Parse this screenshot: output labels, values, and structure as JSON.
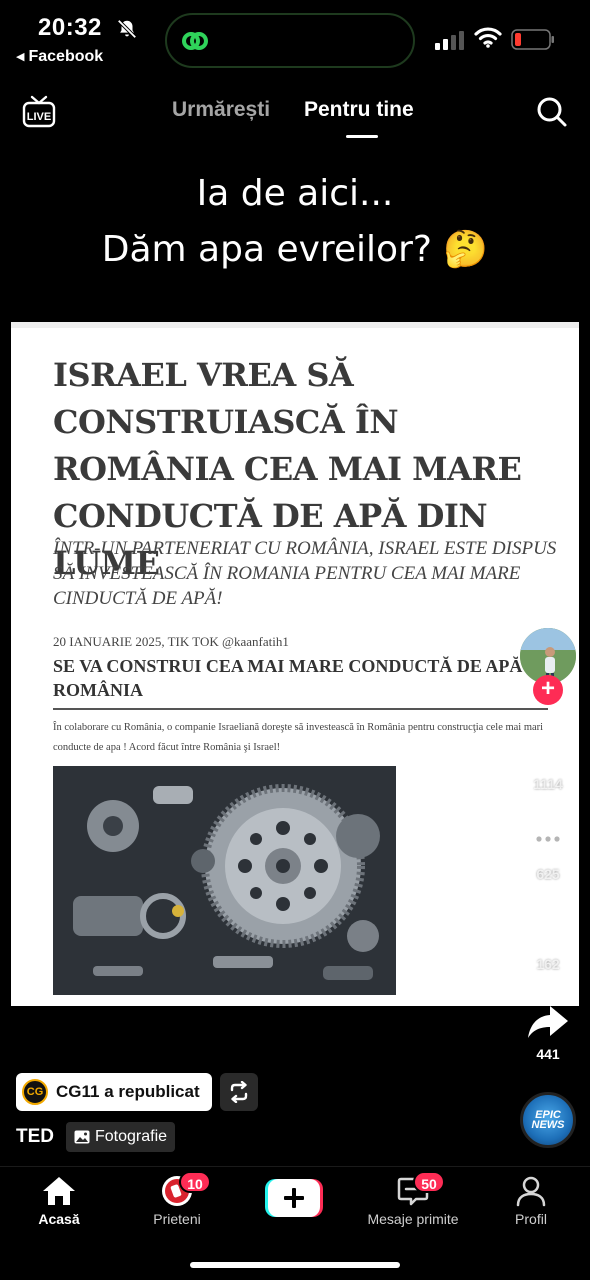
{
  "status_bar": {
    "time": "20:32",
    "back_app": "Facebook",
    "battery_level": 0.15
  },
  "top_nav": {
    "tab_following": "Urmărești",
    "tab_for_you": "Pentru tine",
    "active_tab": "Pentru tine"
  },
  "caption": {
    "line1": "Ia de aici...",
    "line2": "Dăm apa evreilor? 🤔"
  },
  "article": {
    "title": "ISRAEL VREA SĂ CONSTRUIASCĂ ÎN ROMÂNIA CEA MAI MARE CONDUCTĂ DE APĂ DIN LUME",
    "subtitle": "ÎNTR-UN PARTENERIAT CU ROMÂNIA, ISRAEL ESTE DISPUS SĂ INVESTEASCĂ ÎN ROMANIA PENTRU CEA MAI MARE CINDUCTĂ DE APĂ!",
    "date": "20 IANUARIE 2025, TIK TOK @kaanfatih1",
    "heading": "SE VA CONSTRUI CEA MAI MARE CONDUCTĂ DE APĂ ÎN ROMÂNIA",
    "body": "În colaborare cu România,  o companie Israeliană doreşte să investească în România pentru construcţia cele mai mari conducte de apa ! Acord făcut între România şi Israel!"
  },
  "actions": {
    "likes": "1114",
    "comments": "625",
    "saves": "162",
    "shares": "441"
  },
  "repost": {
    "logo_text": "CG",
    "label": "CG11 a republicat"
  },
  "post": {
    "author": "TED",
    "type_label": "Fotografie"
  },
  "music_disc": {
    "line1": "EPIC",
    "line2": "NEWS"
  },
  "bottom_nav": {
    "home": "Acasă",
    "friends": "Prieteni",
    "friends_badge": "10",
    "inbox": "Mesaje primite",
    "inbox_badge": "50",
    "profile": "Profil",
    "active": "Acasă"
  },
  "colors": {
    "accent": "#fe2c55",
    "cyan": "#25f4ee",
    "background": "#000000"
  }
}
